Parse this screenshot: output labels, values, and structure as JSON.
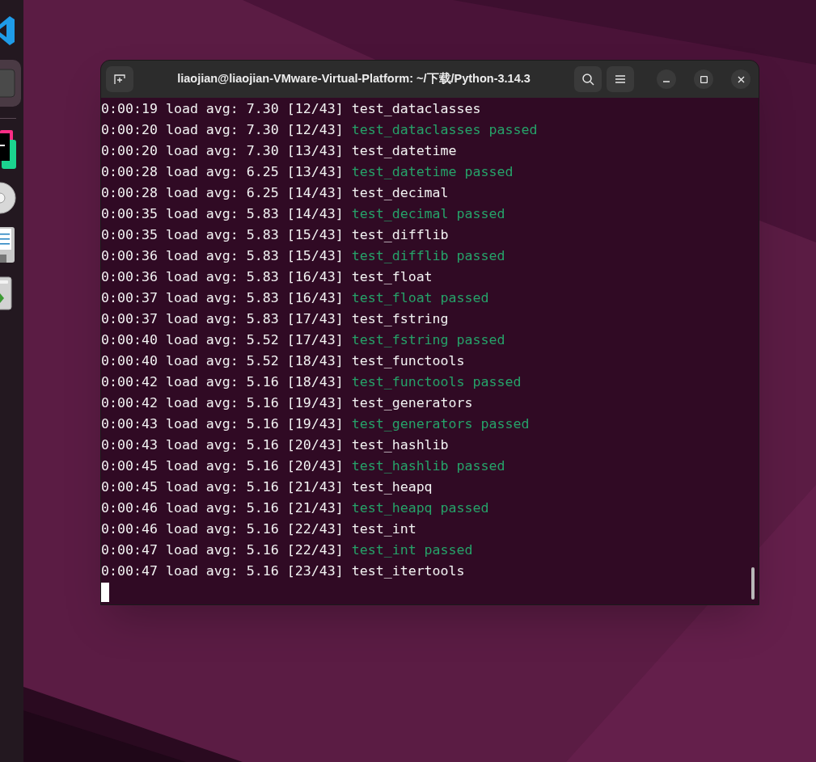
{
  "dock": {
    "items": [
      {
        "kind": "editor-blue",
        "selected": false
      },
      {
        "kind": "terminal",
        "selected": true
      },
      {
        "kind": "ide",
        "selected": false
      },
      {
        "kind": "disc",
        "selected": false
      },
      {
        "kind": "document",
        "selected": false
      },
      {
        "kind": "trash",
        "selected": false
      }
    ]
  },
  "window": {
    "title": "liaojian@liaojian-VMware-Virtual-Platform: ~/下载/Python-3.14.3"
  },
  "terminal": {
    "lines": [
      {
        "prefix": "0:00:19 load avg: 7.30 [12/43]",
        "text": "test_dataclasses",
        "kind": "start"
      },
      {
        "prefix": "0:00:20 load avg: 7.30 [12/43]",
        "text": "test_dataclasses passed",
        "kind": "passed"
      },
      {
        "prefix": "0:00:20 load avg: 7.30 [13/43]",
        "text": "test_datetime",
        "kind": "start"
      },
      {
        "prefix": "0:00:28 load avg: 6.25 [13/43]",
        "text": "test_datetime passed",
        "kind": "passed"
      },
      {
        "prefix": "0:00:28 load avg: 6.25 [14/43]",
        "text": "test_decimal",
        "kind": "start"
      },
      {
        "prefix": "0:00:35 load avg: 5.83 [14/43]",
        "text": "test_decimal passed",
        "kind": "passed"
      },
      {
        "prefix": "0:00:35 load avg: 5.83 [15/43]",
        "text": "test_difflib",
        "kind": "start"
      },
      {
        "prefix": "0:00:36 load avg: 5.83 [15/43]",
        "text": "test_difflib passed",
        "kind": "passed"
      },
      {
        "prefix": "0:00:36 load avg: 5.83 [16/43]",
        "text": "test_float",
        "kind": "start"
      },
      {
        "prefix": "0:00:37 load avg: 5.83 [16/43]",
        "text": "test_float passed",
        "kind": "passed"
      },
      {
        "prefix": "0:00:37 load avg: 5.83 [17/43]",
        "text": "test_fstring",
        "kind": "start"
      },
      {
        "prefix": "0:00:40 load avg: 5.52 [17/43]",
        "text": "test_fstring passed",
        "kind": "passed"
      },
      {
        "prefix": "0:00:40 load avg: 5.52 [18/43]",
        "text": "test_functools",
        "kind": "start"
      },
      {
        "prefix": "0:00:42 load avg: 5.16 [18/43]",
        "text": "test_functools passed",
        "kind": "passed"
      },
      {
        "prefix": "0:00:42 load avg: 5.16 [19/43]",
        "text": "test_generators",
        "kind": "start"
      },
      {
        "prefix": "0:00:43 load avg: 5.16 [19/43]",
        "text": "test_generators passed",
        "kind": "passed"
      },
      {
        "prefix": "0:00:43 load avg: 5.16 [20/43]",
        "text": "test_hashlib",
        "kind": "start"
      },
      {
        "prefix": "0:00:45 load avg: 5.16 [20/43]",
        "text": "test_hashlib passed",
        "kind": "passed"
      },
      {
        "prefix": "0:00:45 load avg: 5.16 [21/43]",
        "text": "test_heapq",
        "kind": "start"
      },
      {
        "prefix": "0:00:46 load avg: 5.16 [21/43]",
        "text": "test_heapq passed",
        "kind": "passed"
      },
      {
        "prefix": "0:00:46 load avg: 5.16 [22/43]",
        "text": "test_int",
        "kind": "start"
      },
      {
        "prefix": "0:00:47 load avg: 5.16 [22/43]",
        "text": "test_int passed",
        "kind": "passed"
      },
      {
        "prefix": "0:00:47 load avg: 5.16 [23/43]",
        "text": "test_itertools",
        "kind": "start"
      }
    ]
  }
}
